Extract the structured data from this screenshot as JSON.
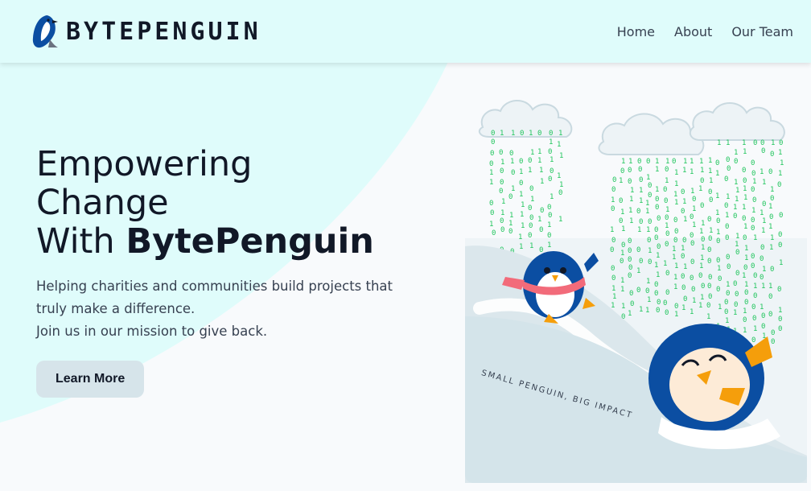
{
  "header": {
    "brand_name": "BYTEPENGUIN",
    "logo_icon": "penguin-logo-icon",
    "nav": [
      {
        "label": "Home"
      },
      {
        "label": "About"
      },
      {
        "label": "Our Team"
      }
    ]
  },
  "hero": {
    "title_line1": "Empowering",
    "title_line2": "Change",
    "title_line3_prefix": "With ",
    "title_line3_bold": "BytePenguin",
    "description_line1": "Helping charities and communities build projects that",
    "description_line2": "truly make a difference.",
    "description_line3": "Join us in our mission to give back.",
    "cta_label": "Learn More"
  },
  "illustration": {
    "caption": "SMALL PENGUIN, BIG IMPACT",
    "subject": "penguins-sledding-illustration"
  },
  "colors": {
    "header_bg": "#dffcfb",
    "accent_shape": "#dffcfb",
    "page_bg": "#f8fafc",
    "penguin_blue": "#0b4ea2",
    "scarf_red": "#f26b7a",
    "beak_orange": "#f59e0b",
    "rain_green": "#22c55e",
    "button_bg": "#d6e4ea"
  }
}
